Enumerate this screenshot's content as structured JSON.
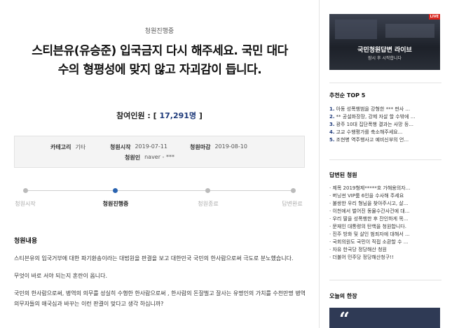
{
  "petition": {
    "status_label": "청원진행중",
    "title": "스티븐유(유승준) 입국금지 다시 해주세요. 국민 대다수의 형평성에 맞지 않고 자괴감이 듭니다.",
    "count_label": "참여인원 : ",
    "count_open": "[ ",
    "count_value": "17,291명",
    "count_close": " ]"
  },
  "info": {
    "category_key": "카테고리",
    "category_value": "기타",
    "start_key": "청원시작",
    "start_value": "2019-07-11",
    "end_key": "청원마감",
    "end_value": "2019-08-10",
    "author_key": "청원인",
    "author_value": "naver - ***"
  },
  "progress": {
    "steps": [
      "청원시작",
      "청원진행중",
      "청원종료",
      "답변완료"
    ],
    "active_index": 1
  },
  "content": {
    "section_title": "청원내용",
    "paragraphs": [
      "스티븐유의 입국거부에 대한 파기환송이라는 대법원을 판결을 보고 대한민국 국민의 한사람으로써 극도로 분노했습니다.",
      "무엇이 바로 서야 되는지 혼란이 옵니다.",
      "국민의 한사람으로써, 병역의 의무를 성실히 수행한 한사람으로써 , 한사람의 돈잘벌고 잘사는 유명인의 가치를 수천만명 병역의무자들의 애국심과 바꾸는 이런 판결이 맞다고 생각 하십니까?"
    ]
  },
  "sidebar": {
    "banner": {
      "live_badge": "LIVE",
      "title": "국민청원답변 라이브",
      "subtitle": "잠시 후 시작합니다"
    },
    "top5": {
      "heading": "추천순 TOP 5",
      "items": [
        {
          "num": "1.",
          "text": "아동 성폭행범을 강형한 *** 판사 ..."
        },
        {
          "num": "2.",
          "text": "** 공설화장장, 강제 자살 할 수밖에 ..."
        },
        {
          "num": "3.",
          "text": "광주 10대 집단폭행 결과는 사망 등..."
        },
        {
          "num": "4.",
          "text": "고교 수행평가를 축소해주세요..."
        },
        {
          "num": "5.",
          "text": "조현병 역주행사고 예비신부의 언..."
        }
      ]
    },
    "answered": {
      "heading": "답변된 청원",
      "items": [
        "· 제목 2019형제*****호 가해용의자...",
        "· 버닝썬 VIP룸 6인을 수사해 주세요",
        "· 불쌍한 우리 형님을 찾아주시고, 살...",
        "· 이천에서 벌어진 동물수간사건에 대...",
        "· 우리 딸을 성폭행한 후 잔인하게 목...",
        "· 문재인 대통령의 탄핵을 청원합니다.",
        "· 진주 방화 및 살인 범죄자에 대해서 ...",
        "· 국회의원도 국민이 직접 소환할 수 ...",
        "· 자유 한국당 정당해산 청원",
        "· 더불어 민주당 정당해산청구!!"
      ]
    },
    "today": {
      "heading": "오늘의 한장",
      "quote_mark": "“"
    }
  },
  "colors": {
    "accent": "#1e3a7a",
    "progress_active": "#2a63b0",
    "live_red": "#d9251d"
  }
}
